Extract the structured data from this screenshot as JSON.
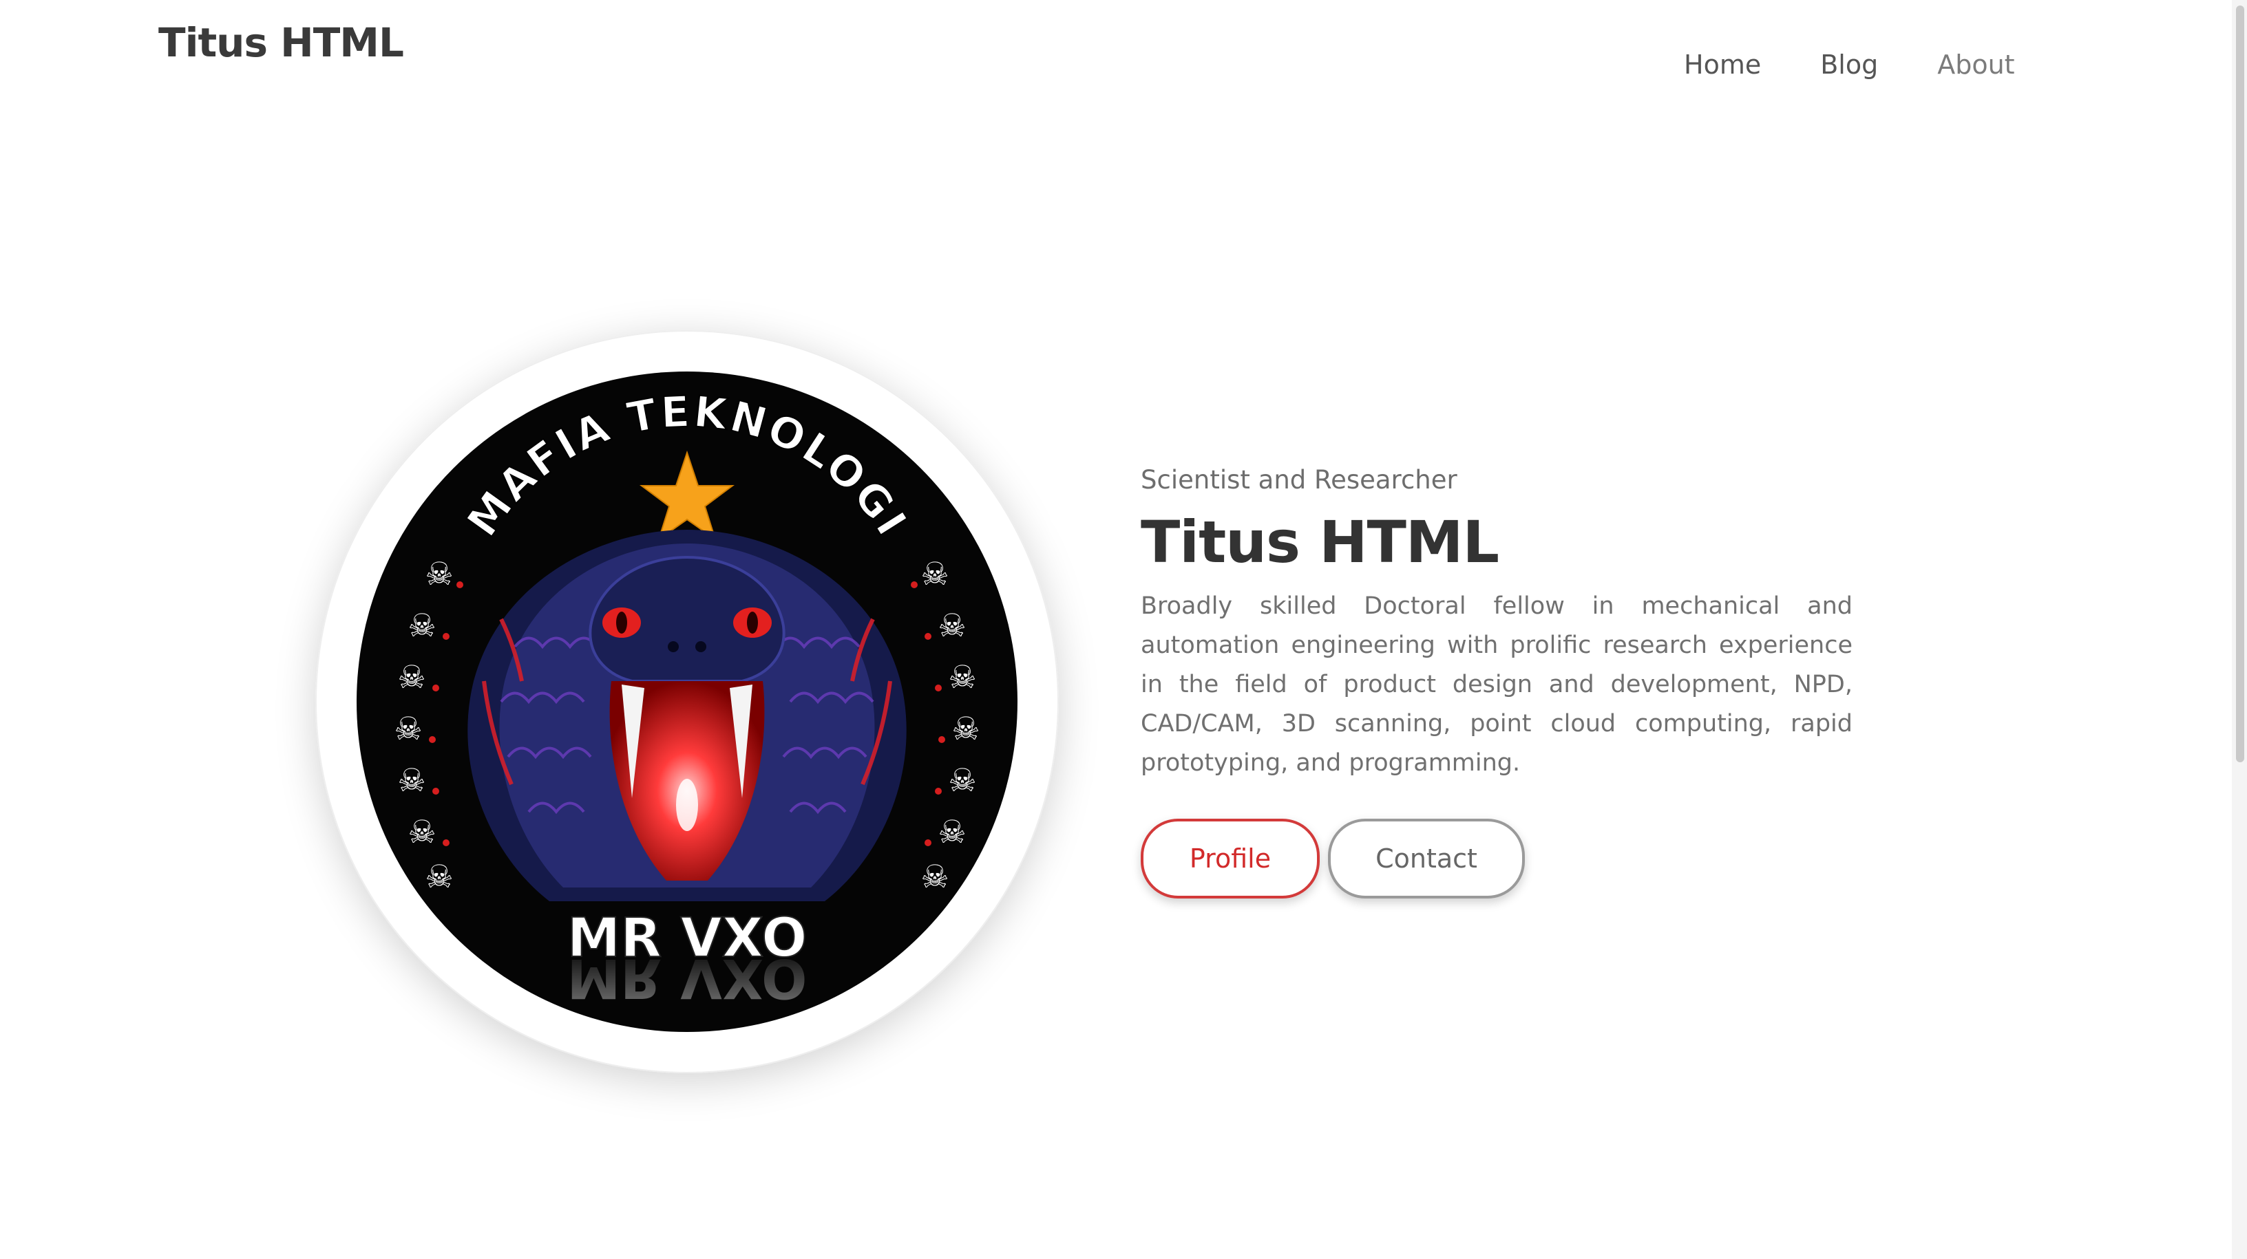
{
  "header": {
    "brand": "Titus HTML",
    "nav": [
      {
        "label": "Home"
      },
      {
        "label": "Blog"
      },
      {
        "label": "About"
      }
    ]
  },
  "hero": {
    "image": {
      "top_text": "MAFIA TEKNOLOGI",
      "bottom_text": "MR VXO"
    },
    "subtitle": "Scientist and Researcher",
    "title": "Titus HTML",
    "description": "Broadly skilled Doctoral fellow in mechanical and automation engineering with prolific research experience in the field of product design and development, NPD, CAD/CAM, 3D scanning, point cloud computing, rapid prototyping, and programming.",
    "buttons": {
      "profile": "Profile",
      "contact": "Contact"
    }
  },
  "colors": {
    "accent": "#d22a2a",
    "text_dark": "#333333",
    "text_muted": "#707070"
  }
}
